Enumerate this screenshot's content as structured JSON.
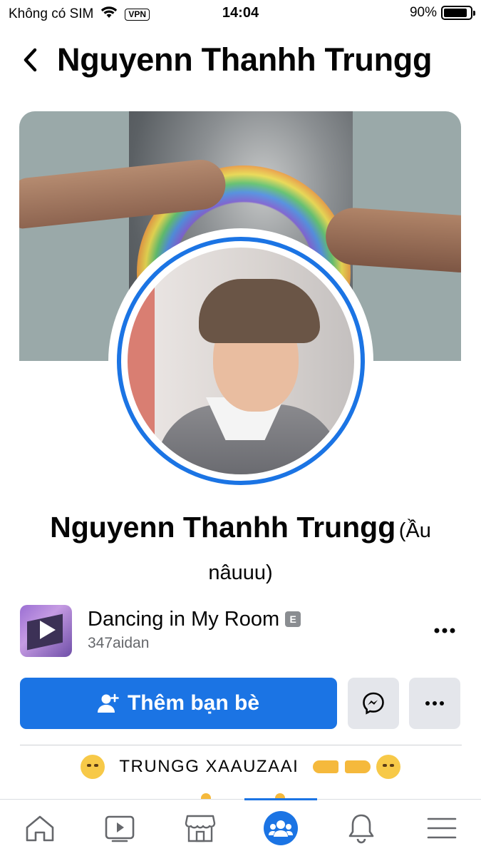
{
  "status_bar": {
    "carrier": "Không có SIM",
    "vpn": "VPN",
    "time": "14:04",
    "battery": "90%",
    "battery_level": 0.9
  },
  "header": {
    "title": "Nguyenn Thanhh Trungg"
  },
  "profile": {
    "name": "Nguyenn Thanhh Trungg",
    "alternate_name": "(Ầu nâuuu)"
  },
  "music": {
    "title": "Dancing in My Room",
    "explicit_badge": "E",
    "artist": "347aidan"
  },
  "actions": {
    "add_friend_label": "Thêm bạn bè"
  },
  "bio": {
    "text": "TRUNGG XAAUZAAI"
  },
  "bottom_nav": {
    "items": [
      "home-icon",
      "watch-icon",
      "marketplace-icon",
      "groups-icon",
      "notifications-icon",
      "menu-icon"
    ],
    "active": "groups-icon"
  },
  "colors": {
    "accent": "#1b74e4",
    "secondary_button": "#e4e6eb",
    "muted_text": "#65676b"
  }
}
